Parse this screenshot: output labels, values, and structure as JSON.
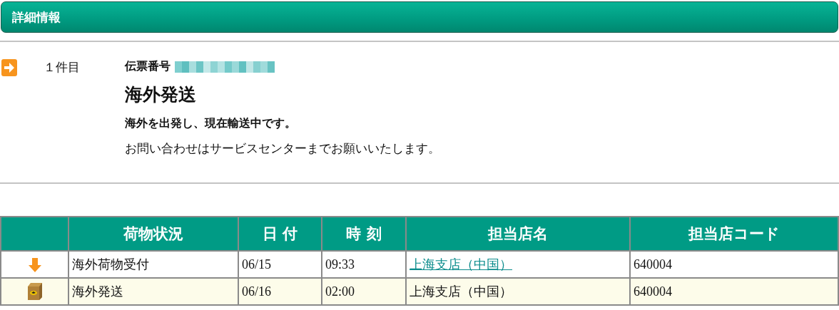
{
  "header": {
    "title": "詳細情報"
  },
  "item": {
    "index": "１件目",
    "number_label": "伝票番号",
    "status": "海外発送",
    "message": "海外を出発し、現在輸送中です。",
    "note": "お問い合わせはサービスセンターまでお願いいたします。"
  },
  "table": {
    "columns": [
      "荷物状況",
      "日 付",
      "時 刻",
      "担当店名",
      "担当店コード"
    ],
    "rows": [
      {
        "kind": "arrow",
        "status": "海外荷物受付",
        "date": "06/15",
        "time": "09:33",
        "store": "上海支店（中国）",
        "store_link": true,
        "code": "640004",
        "current": false
      },
      {
        "kind": "box",
        "status": "海外発送",
        "date": "06/16",
        "time": "02:00",
        "store": "上海支店（中国）",
        "store_link": false,
        "code": "640004",
        "current": true
      }
    ]
  }
}
